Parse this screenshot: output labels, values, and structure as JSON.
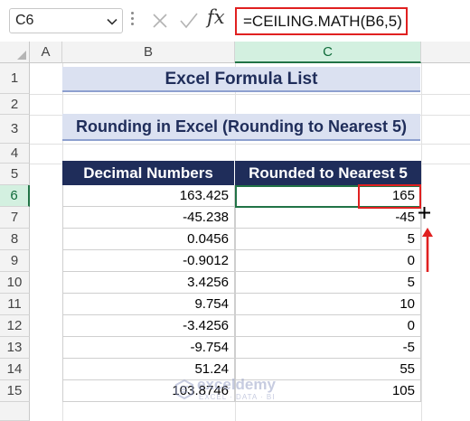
{
  "formula_bar": {
    "name_box": "C6",
    "fx_label": "fx",
    "formula": "=CEILING.MATH(B6,5)"
  },
  "columns": [
    "A",
    "B",
    "C"
  ],
  "selected_column": "C",
  "rows": [
    "1",
    "2",
    "3",
    "4",
    "5",
    "6",
    "7",
    "8",
    "9",
    "10",
    "11",
    "12",
    "13",
    "14",
    "15"
  ],
  "selected_row": "6",
  "sheet": {
    "title": "Excel Formula List",
    "subtitle": "Rounding in Excel (Rounding to Nearest 5)",
    "headers": [
      "Decimal Numbers",
      "Rounded to Nearest 5"
    ],
    "data": [
      [
        "163.425",
        "165"
      ],
      [
        "-45.238",
        "-45"
      ],
      [
        "0.0456",
        "5"
      ],
      [
        "-0.9012",
        "0"
      ],
      [
        "3.4256",
        "5"
      ],
      [
        "9.754",
        "10"
      ],
      [
        "-3.4256",
        "0"
      ],
      [
        "-9.754",
        "-5"
      ],
      [
        "51.24",
        "55"
      ],
      [
        "103.8746",
        "105"
      ]
    ]
  },
  "watermark": {
    "name": "exceldemy",
    "tagline": "EXCEL · DATA · BI"
  },
  "colors": {
    "header_fill": "#1f2d5a",
    "title_fill": "#dbe1f1",
    "highlight": "#e02020",
    "selection": "#217346"
  }
}
